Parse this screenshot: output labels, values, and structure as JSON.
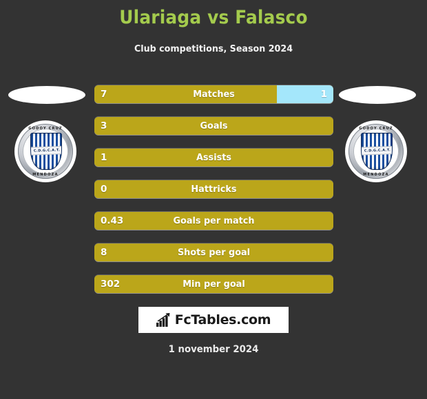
{
  "header": {
    "title": "Ulariaga vs Falasco",
    "subtitle": "Club competitions, Season 2024",
    "title_color": "#a4cb4d"
  },
  "players": {
    "left": {
      "photo_placeholder": "player-photo-placeholder",
      "club": {
        "name_top": "GODOY CRUZ",
        "name_bottom": "MENDOZA",
        "band_text": "C.D.G.C.A.T.",
        "primary_color": "#1b4fa0"
      }
    },
    "right": {
      "photo_placeholder": "player-photo-placeholder",
      "club": {
        "name_top": "GODOY CRUZ",
        "name_bottom": "MENDOZA",
        "band_text": "C.D.G.C.A.T.",
        "primary_color": "#1b4fa0"
      }
    }
  },
  "colors": {
    "background": "#333333",
    "bar_left": "#bba61a",
    "bar_right": "#a4e7fb",
    "label_text": "#ffffff"
  },
  "stats": [
    {
      "label": "Matches",
      "left_value": "7",
      "right_value": "1",
      "left_pct": 76.5
    },
    {
      "label": "Goals",
      "left_value": "3",
      "right_value": "",
      "left_pct": 100
    },
    {
      "label": "Assists",
      "left_value": "1",
      "right_value": "",
      "left_pct": 100
    },
    {
      "label": "Hattricks",
      "left_value": "0",
      "right_value": "",
      "left_pct": 100
    },
    {
      "label": "Goals per match",
      "left_value": "0.43",
      "right_value": "",
      "left_pct": 100
    },
    {
      "label": "Shots per goal",
      "left_value": "8",
      "right_value": "",
      "left_pct": 100
    },
    {
      "label": "Min per goal",
      "left_value": "302",
      "right_value": "",
      "left_pct": 100
    }
  ],
  "footer": {
    "logo_text": "FcTables.com",
    "logo_icon": "bar-chart-arrow-icon",
    "date": "1 november 2024"
  }
}
